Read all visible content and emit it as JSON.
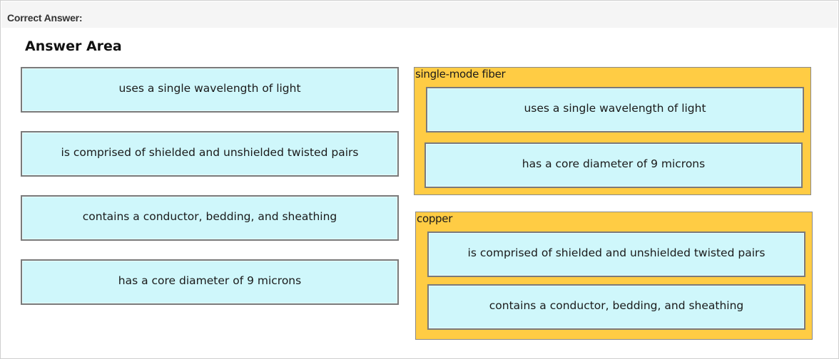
{
  "header": {
    "label": "Correct Answer:"
  },
  "answer_area": {
    "title": "Answer Area"
  },
  "source_items": [
    "uses a single wavelength of light",
    "is comprised of shielded and unshielded twisted pairs",
    "contains a conductor, bedding, and sheathing",
    "has a core diameter of 9 microns"
  ],
  "targets": [
    {
      "label": "single-mode fiber",
      "items": [
        "uses a single wavelength of light",
        "has a core diameter of 9 microns"
      ]
    },
    {
      "label": "copper",
      "items": [
        "is comprised of shielded and unshielded twisted pairs",
        "contains a conductor, bedding, and sheathing"
      ]
    }
  ],
  "colors": {
    "tile_fill": "#cff7fb",
    "target_fill": "#ffcc44",
    "header_fill": "#f5f5f5"
  }
}
